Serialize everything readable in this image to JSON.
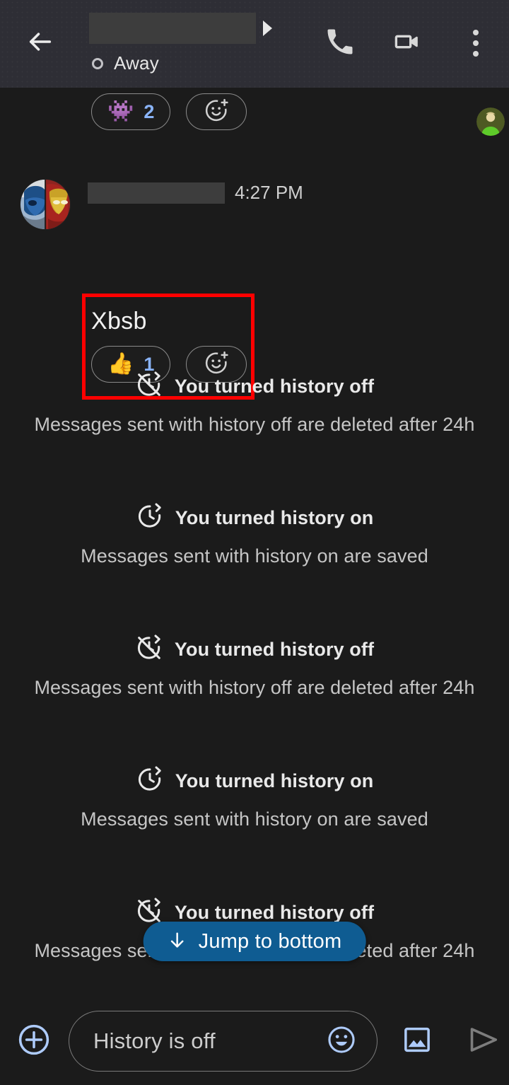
{
  "header": {
    "back_icon": "back-arrow-icon",
    "title_redacted": "",
    "expand_icon": "caret-right-icon",
    "status_label": "Away",
    "call_icon": "phone-icon",
    "video_icon": "video-camera-icon",
    "overflow_icon": "more-vert-icon"
  },
  "top_reactions": {
    "items": [
      {
        "emoji": "👾",
        "emoji_name": "alien-monster-emoji",
        "count": "2"
      }
    ],
    "add_label": "add-reaction-icon"
  },
  "message": {
    "avatar_name": "sender-avatar",
    "sender_redacted": "",
    "timestamp": "4:27 PM",
    "text": "Xbsb",
    "reactions": [
      {
        "emoji": "👍",
        "emoji_name": "thumbs-up-emoji",
        "count": "1"
      }
    ],
    "add_label": "add-reaction-icon",
    "highlighted": true,
    "highlight_color": "#ff0000"
  },
  "events": [
    {
      "icon": "history-off-icon",
      "title": "You turned history off",
      "subtitle": "Messages sent with history off are deleted after 24h"
    },
    {
      "icon": "history-on-icon",
      "title": "You turned history on",
      "subtitle": "Messages sent with history on are saved"
    },
    {
      "icon": "history-off-icon",
      "title": "You turned history off",
      "subtitle": "Messages sent with history off are deleted after 24h"
    },
    {
      "icon": "history-on-icon",
      "title": "You turned history on",
      "subtitle": "Messages sent with history on are saved"
    },
    {
      "icon": "history-off-icon",
      "title": "You turned history off",
      "subtitle": "Messages sent with history off are deleted after 24h"
    }
  ],
  "jump_to_bottom": {
    "label": "Jump to bottom",
    "icon": "arrow-down-icon",
    "background": "#0f5c92"
  },
  "composer": {
    "plus_icon": "add-circle-icon",
    "placeholder": "History is off",
    "value": "",
    "emoji_icon": "emoji-smiley-icon",
    "image_icon": "image-icon",
    "send_icon": "send-icon"
  },
  "colors": {
    "accent_blue": "#8ab4f8",
    "header_bg": "#2e2e35",
    "body_bg": "#1b1b1b",
    "highlight": "#ff0000"
  }
}
